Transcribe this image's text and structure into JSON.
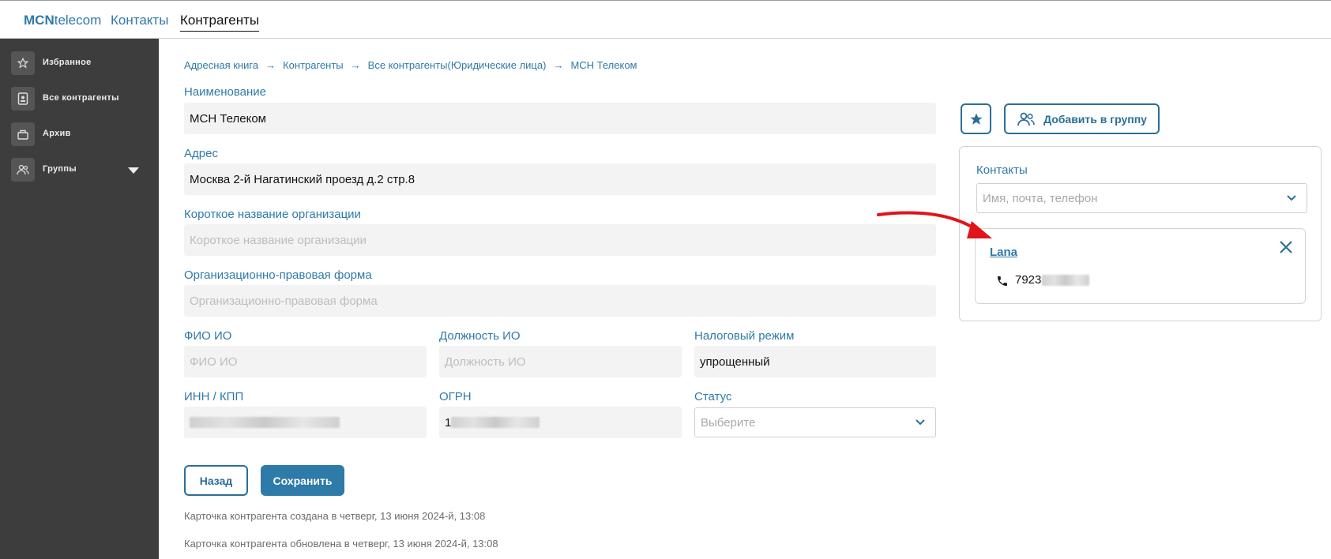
{
  "topbar": {
    "logo_bold": "MCN",
    "logo_rest": "telecom",
    "nav": [
      {
        "label": "Контакты",
        "active": false
      },
      {
        "label": "Контрагенты",
        "active": true
      }
    ]
  },
  "sidebar": {
    "items": [
      {
        "label": "Избранное",
        "icon": "star-icon"
      },
      {
        "label": "Все контрагенты",
        "icon": "contact-card-icon"
      },
      {
        "label": "Архив",
        "icon": "archive-icon"
      },
      {
        "label": "Группы",
        "icon": "group-icon"
      }
    ]
  },
  "breadcrumb": [
    "Адресная книга",
    "Контрагенты",
    "Все контрагенты(Юридические лица)",
    "МСН Телеком"
  ],
  "form": {
    "name": {
      "label": "Наименование",
      "value": "МСН Телеком"
    },
    "address": {
      "label": "Адрес",
      "value": "Москва 2-й Нагатинский проезд д.2 стр.8"
    },
    "short_name": {
      "label": "Короткое название организации",
      "placeholder": "Короткое название организации"
    },
    "legal_form": {
      "label": "Организационно-правовая форма",
      "placeholder": "Организационно-правовая форма"
    },
    "director_name": {
      "label": "ФИО ИО",
      "placeholder": "ФИО ИО"
    },
    "director_position": {
      "label": "Должность ИО",
      "placeholder": "Должность ИО"
    },
    "tax_regime": {
      "label": "Налоговый режим",
      "value": "упрощенный"
    },
    "inn_kpp": {
      "label": "ИНН / КПП",
      "value": ""
    },
    "ogrn": {
      "label": "ОГРН",
      "value_prefix": "1"
    },
    "status": {
      "label": "Статус",
      "placeholder": "Выберите"
    }
  },
  "buttons": {
    "back": "Назад",
    "save": "Сохранить",
    "add_group": "Добавить в группу"
  },
  "meta": {
    "created": "Карточка контрагента создана в четверг, 13 июня 2024-й, 13:08",
    "updated": "Карточка контрагента обновлена в четверг, 13 июня 2024-й, 13:08"
  },
  "contacts": {
    "label": "Контакты",
    "search_placeholder": "Имя, почта, телефон",
    "items": [
      {
        "name": "Lana",
        "phone_prefix": "7923"
      }
    ]
  },
  "colors": {
    "accent": "#2e7aa8",
    "sidebar_bg": "#3d3d3d",
    "arrow": "#e0151b"
  }
}
